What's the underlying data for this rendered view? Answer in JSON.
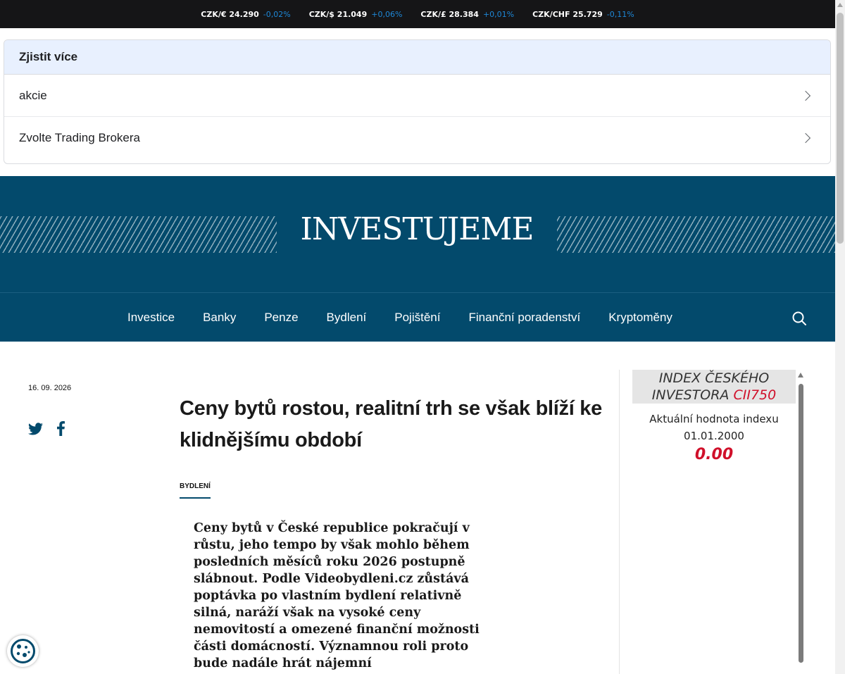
{
  "ticker": [
    {
      "label": "CZK/€ 24.290",
      "change": "-0,02%"
    },
    {
      "label": "CZK/$ 21.049",
      "change": "+0,06%"
    },
    {
      "label": "CZK/£ 28.384",
      "change": "+0,01%"
    },
    {
      "label": "CZK/CHF 25.729",
      "change": "-0,11%"
    }
  ],
  "more": {
    "heading": "Zjistit více",
    "items": [
      "akcie",
      "Zvolte Trading Brokera"
    ]
  },
  "brand": {
    "logo_text": "INVESTUJEME"
  },
  "nav": {
    "items": [
      "Investice",
      "Banky",
      "Penze",
      "Bydlení",
      "Pojištění",
      "Finanční poradenství",
      "Kryptoměny"
    ]
  },
  "article": {
    "date": "16. 09. 2026",
    "title": "Ceny bytů rostou, realitní trh se však blíží ke klidnějšímu období",
    "category": "BYDLENÍ",
    "lead": "Ceny bytů v České republice pokračují v růstu, jeho tempo by však mohlo během posledních měsíců roku 2026 postupně slábnout. Podle Videobydleni.cz zůstává poptávka po vlastním bydlení relativně silná, naráží však na vysoké ceny nemovitostí a omezené finanční možnosti části domácností. Významnou roli proto bude nadále hrát nájemní"
  },
  "index_widget": {
    "title_main": "INDEX ČESKÉHO INVESTORA",
    "title_code": "CII750",
    "subtitle": "Aktuální hodnota indexu",
    "date": "01.01.2000",
    "value": "0.00"
  },
  "colors": {
    "brand": "#034a6c",
    "ticker_bg": "#151517",
    "ticker_change": "#1e88d8",
    "index_red": "#d0102a"
  }
}
